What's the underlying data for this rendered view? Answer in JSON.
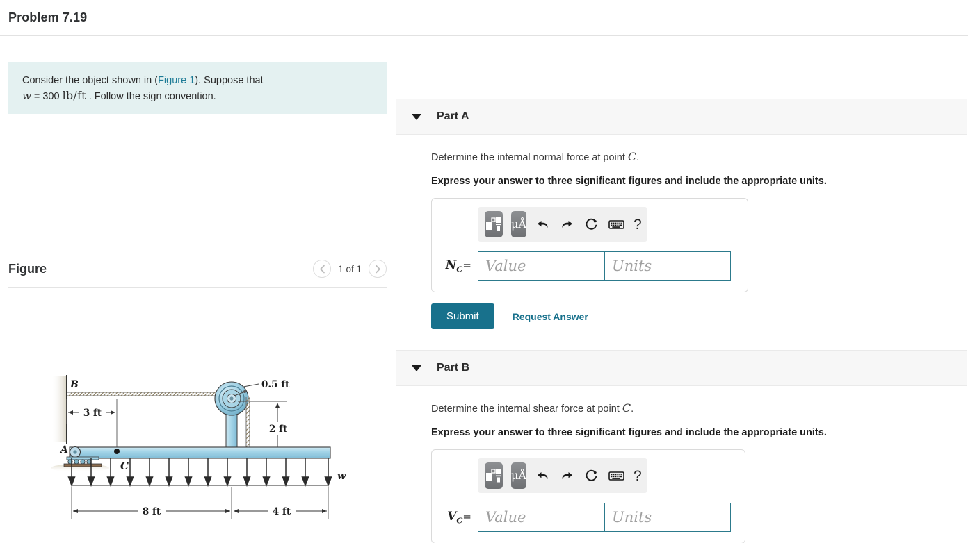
{
  "header": {
    "problem_title": "Problem 7.19"
  },
  "statement": {
    "text_before_link": "Consider the object shown in (",
    "link_label": "Figure 1",
    "text_after_link": "). Suppose that",
    "var": "w",
    "equals": "= 300",
    "units": "lb/ft",
    "tail": ". Follow the sign convention."
  },
  "figure_panel": {
    "title": "Figure",
    "pager_label": "1 of 1",
    "prev_icon": "chevron-left-icon",
    "next_icon": "chevron-right-icon"
  },
  "figure_diagram": {
    "labels": {
      "point_a": "A",
      "point_b": "B",
      "point_c": "C",
      "load_symbol": "w",
      "dim_3ft": "3 ft",
      "dim_0_5ft": "0.5 ft",
      "dim_2ft": "2 ft",
      "dim_8ft": "8 ft",
      "dim_4ft": "4 ft"
    },
    "colors": {
      "beam_fill": "#9fd2e6",
      "beam_stroke": "#3a3a3a",
      "pulley_fill": "#8ec6dd",
      "wall_shadow": "#ded9c8"
    }
  },
  "parts": [
    {
      "id": "part-a",
      "label": "Part A",
      "caret_icon": "caret-down-icon",
      "prompt_before": "Determine the internal normal force at point ",
      "prompt_symbol": "C",
      "prompt_after": ".",
      "instruction": "Express your answer to three significant figures and include the appropriate units.",
      "toolbar": {
        "template_icon": "math-template-icon",
        "units_icon": "units-micro-angstrom-icon",
        "units_icon_label": "μÅ",
        "undo_icon": "undo-arrow-icon",
        "redo_icon": "redo-arrow-icon",
        "reset_icon": "reset-circular-arrow-icon",
        "keyboard_icon": "keyboard-icon",
        "help_icon": "question-mark-icon",
        "help_label": "?"
      },
      "variable": "N",
      "variable_sub": "C",
      "equals_sign": "=",
      "value_placeholder": "Value",
      "units_placeholder": "Units",
      "value": "",
      "units": "",
      "submit_label": "Submit",
      "request_label": "Request Answer",
      "has_actions": true
    },
    {
      "id": "part-b",
      "label": "Part B",
      "caret_icon": "caret-down-icon",
      "prompt_before": "Determine the internal shear force at point ",
      "prompt_symbol": "C",
      "prompt_after": ".",
      "instruction": "Express your answer to three significant figures and include the appropriate units.",
      "toolbar": {
        "template_icon": "math-template-icon",
        "units_icon": "units-micro-angstrom-icon",
        "units_icon_label": "μÅ",
        "undo_icon": "undo-arrow-icon",
        "redo_icon": "redo-arrow-icon",
        "reset_icon": "reset-circular-arrow-icon",
        "keyboard_icon": "keyboard-icon",
        "help_icon": "question-mark-icon",
        "help_label": "?"
      },
      "variable": "V",
      "variable_sub": "C",
      "equals_sign": "=",
      "value_placeholder": "Value",
      "units_placeholder": "Units",
      "value": "",
      "units": "",
      "has_actions": false
    }
  ],
  "colors": {
    "accent_teal": "#18718c",
    "link_teal": "#1d7b96",
    "statement_bg": "#e4f1f1",
    "part_header_bg": "#f7f7f7",
    "input_border": "#2c7a8c"
  }
}
